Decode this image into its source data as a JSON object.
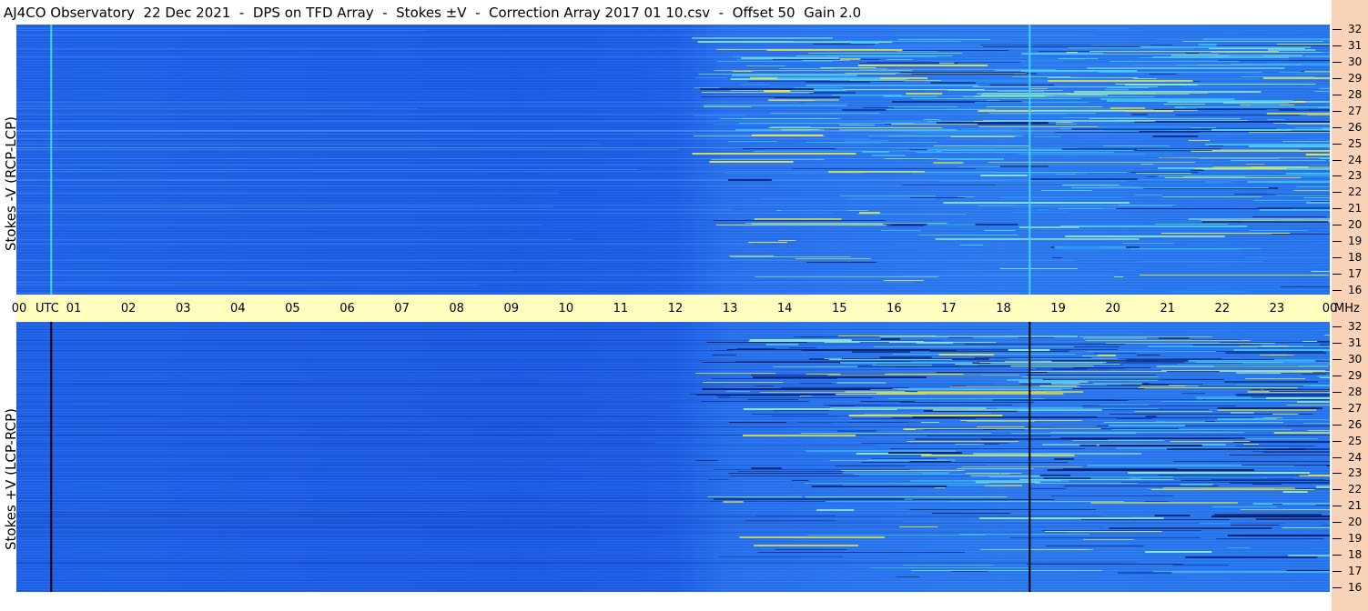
{
  "header": {
    "title": "AJ4CO Observatory  22 Dec 2021  -  DPS on TFD Array  -  Stokes ±V  -  Correction Array 2017 01 10.csv  -  Offset 50  Gain 2.0"
  },
  "axis": {
    "utc_label": "UTC",
    "mhz_unit": "MHz",
    "time_ticks": [
      "00",
      "01",
      "02",
      "03",
      "04",
      "05",
      "06",
      "07",
      "08",
      "09",
      "10",
      "11",
      "12",
      "13",
      "14",
      "15",
      "16",
      "17",
      "18",
      "19",
      "20",
      "21",
      "22",
      "23",
      "00"
    ],
    "freq_ticks": [
      "32",
      "31",
      "30",
      "29",
      "28",
      "27",
      "26",
      "25",
      "24",
      "23",
      "22",
      "21",
      "20",
      "19",
      "18",
      "17",
      "16"
    ]
  },
  "chart_data": [
    {
      "type": "heatmap",
      "ylabel": "Stokes -V (RCP-LCP)",
      "x_range_utc_hours": [
        0,
        24
      ],
      "y_range_mhz": [
        16,
        32
      ],
      "notes": "Radio spectrogram; activity (bright cyan/yellow streaks) begins after ~12:30 UTC; vertical cyan line near 00:35 and 18:30 UTC",
      "colors": {
        "background": "#1e62ea",
        "active": "#3fbff5",
        "highlight": "#e5e34a"
      }
    },
    {
      "type": "heatmap",
      "ylabel": "Stokes +V (LCP-RCP)",
      "x_range_utc_hours": [
        0,
        24
      ],
      "y_range_mhz": [
        16,
        32
      ],
      "notes": "Radio spectrogram; dark streaks after ~12:00 UTC; vertical black line near 00:35 and 18:30 UTC",
      "colors": {
        "background": "#1e62ea",
        "active": "#0a2a8a",
        "highlight": "#e5e34a"
      }
    }
  ]
}
